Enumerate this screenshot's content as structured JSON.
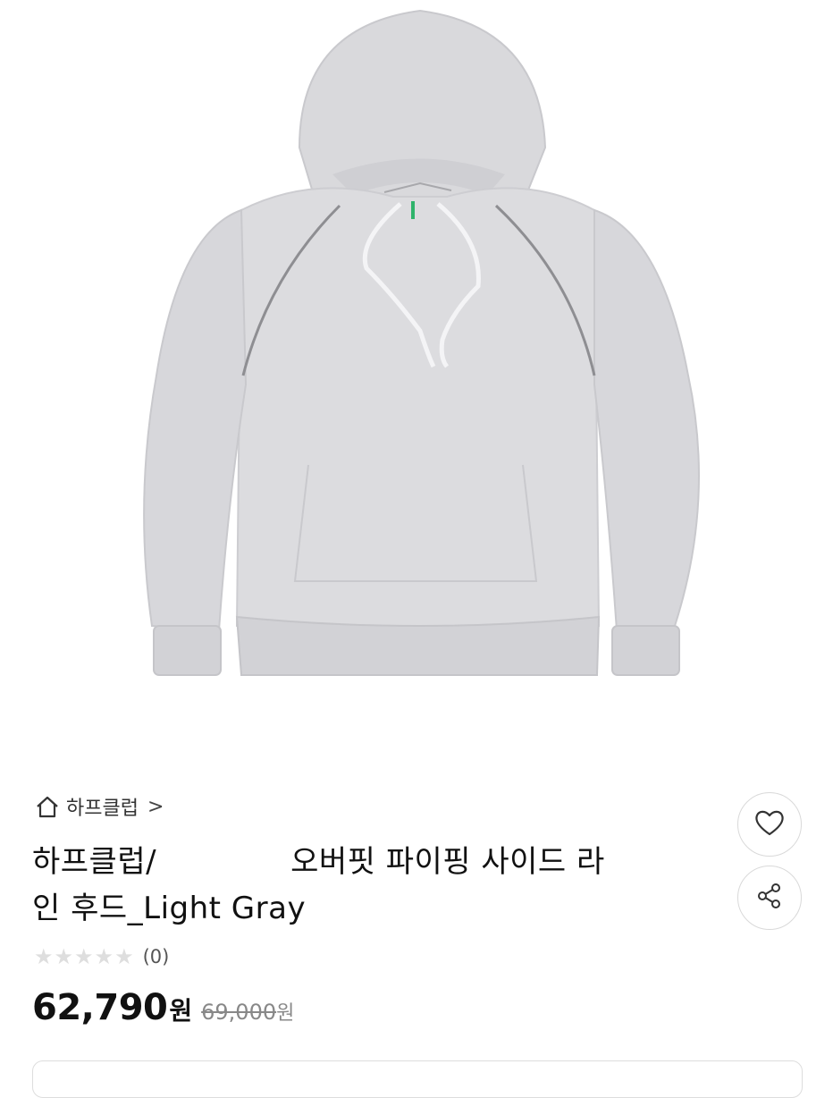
{
  "product": {
    "image_alt": "Light gray raglan hoodie with piping",
    "brand": "하프클럽",
    "brand_chevron": ">",
    "title_part1": "하프클럽/",
    "title_part2": "오버핏 파이핑 사이드 라",
    "title_line2": "인 후드_Light Gray",
    "rating_count": "(0)",
    "rating_value": 0,
    "sale_price": "62,790",
    "sale_unit": "원",
    "original_price": "69,000",
    "original_unit": "원"
  },
  "icons": {
    "home": "home-icon",
    "wish": "heart-icon",
    "share": "share-icon",
    "star": "star-icon"
  },
  "colors": {
    "hoodie": "#d9d9dc",
    "piping": "#8e8e92",
    "star_empty": "#dedede"
  }
}
